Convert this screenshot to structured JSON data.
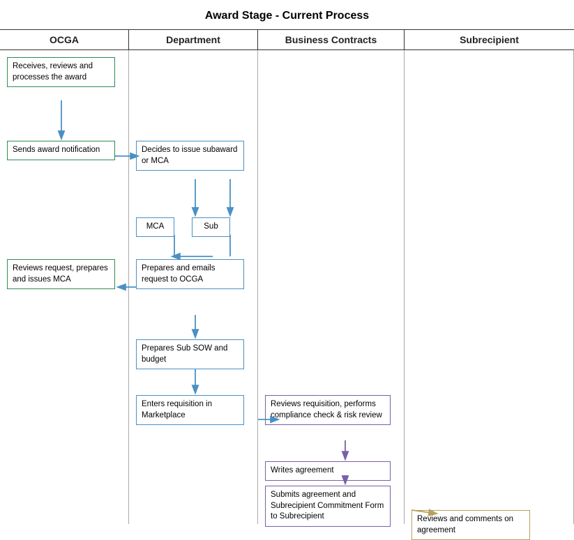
{
  "title": "Award Stage - Current Process",
  "headers": {
    "ocga": "OCGA",
    "department": "Department",
    "business_contracts": "Business Contracts",
    "subrecipient": "Subrecipient"
  },
  "boxes": {
    "receives": "Receives, reviews and processes the award",
    "sends": "Sends award notification",
    "reviews_request": "Reviews request, prepares and issues MCA",
    "decides": "Decides to issue subaward or MCA",
    "mca": "MCA",
    "sub": "Sub",
    "prepares_emails": "Prepares and emails request to OCGA",
    "prepares_sow": "Prepares Sub SOW and budget",
    "enters_req": "Enters requisition in Marketplace",
    "reviews_req": "Reviews requisition, performs compliance check & risk review",
    "writes": "Writes agreement",
    "submits": "Submits agreement and Subrecipient Commitment Form to Subrecipient",
    "reviews_comments": "Reviews and comments on agreement"
  }
}
